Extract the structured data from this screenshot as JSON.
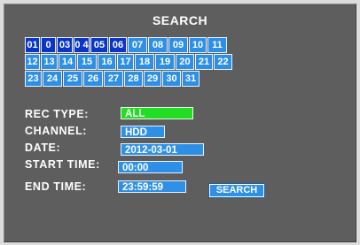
{
  "title": "SEARCH",
  "calendar": {
    "rows": [
      [
        "01",
        "0 2",
        "03",
        "0 4",
        "05",
        "06",
        "07",
        "08",
        "09",
        "10",
        "11"
      ],
      [
        "12",
        "13",
        "14",
        "15",
        "16",
        "17",
        "18",
        "19",
        "20",
        "21",
        "22"
      ],
      [
        "23",
        "24",
        "25",
        "26",
        "27",
        "28",
        "29",
        "30",
        "31"
      ]
    ],
    "recorded_days": [
      "01",
      "0 2",
      "03",
      "0 4",
      "05",
      "06"
    ]
  },
  "form": {
    "rec_type_label": "REC TYPE:",
    "rec_type_value": "ALL",
    "channel_label": "CHANNEL:",
    "channel_value": "HDD",
    "date_label": "DATE:",
    "date_value": "2012-03-01",
    "start_time_label": "START TIME:",
    "start_time_value": "00:00",
    "end_time_label": "END  TIME:",
    "end_time_value": "23:59:59",
    "search_button": "SEARCH"
  },
  "colors": {
    "background": "#5e5e5e",
    "recorded_day": "#0a35c9",
    "day": "#2d8fe6",
    "rec_type_highlight": "#22dd22"
  }
}
